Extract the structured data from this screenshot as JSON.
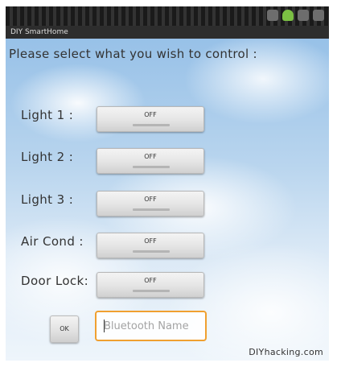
{
  "app": {
    "title": "DIY SmartHome"
  },
  "prompt": "Please select what you wish to control :",
  "controls": [
    {
      "label": "Light 1 :",
      "state": "OFF"
    },
    {
      "label": "Light 2 :",
      "state": "OFF"
    },
    {
      "label": "Light 3 :",
      "state": "OFF"
    },
    {
      "label": "Air Cond :",
      "state": "OFF"
    },
    {
      "label": "Door Lock:",
      "state": "OFF"
    }
  ],
  "ok_button": "OK",
  "bluetooth": {
    "placeholder": "Bluetooth Name",
    "value": ""
  },
  "footer": "DIYhacking.com"
}
